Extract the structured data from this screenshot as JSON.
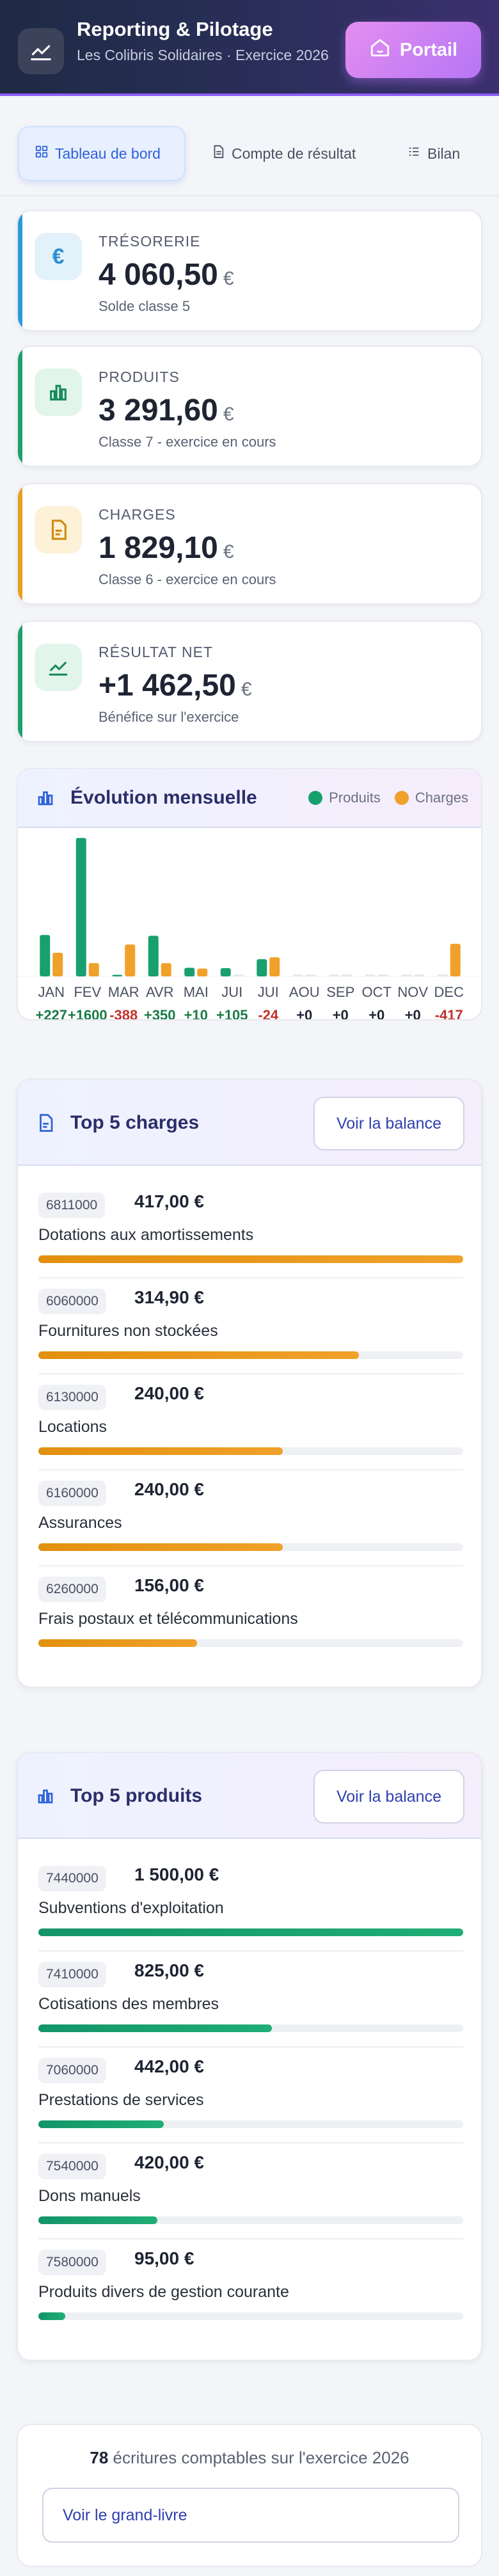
{
  "header": {
    "title": "Reporting & Pilotage",
    "subtitle": "Les Colibris Solidaires · Exercice 2026",
    "portal_label": "Portail"
  },
  "tabs": [
    {
      "label": "Tableau de bord",
      "active": true
    },
    {
      "label": "Compte de résultat",
      "active": false
    },
    {
      "label": "Bilan",
      "active": false
    }
  ],
  "stats": [
    {
      "label": "TRÉSORERIE",
      "value": "4 060,50",
      "currency": "€",
      "sub": "Solde classe 5",
      "accent": "#2b9bd8",
      "icon": "euro-icon"
    },
    {
      "label": "PRODUITS",
      "value": "3 291,60",
      "currency": "€",
      "sub": "Classe 7 - exercice en cours",
      "accent": "#1ea06a",
      "icon": "bar-chart-icon"
    },
    {
      "label": "CHARGES",
      "value": "1 829,10",
      "currency": "€",
      "sub": "Classe 6 - exercice en cours",
      "accent": "#e5a020",
      "icon": "document-icon"
    },
    {
      "label": "RÉSULTAT NET",
      "value": "+1 462,50",
      "currency": "€",
      "sub": "Bénéfice sur l'exercice",
      "accent": "#1ea06a",
      "icon": "trend-icon"
    }
  ],
  "chart": {
    "title": "Évolution mensuelle",
    "legend_produits": "Produits",
    "legend_charges": "Charges",
    "colors": {
      "produits": "#18a06e",
      "charges": "#f0a12a",
      "positive": "#1a7a47",
      "negative": "#c0312b"
    }
  },
  "chart_data": {
    "type": "bar",
    "categories": [
      "JAN",
      "FEV",
      "MAR",
      "AVR",
      "MAI",
      "JUI",
      "JUI",
      "AOU",
      "SEP",
      "OCT",
      "NOV",
      "DEC"
    ],
    "series": [
      {
        "name": "Produits",
        "values": [
          530,
          1770,
          20,
          520,
          110,
          105,
          220,
          0,
          0,
          0,
          0,
          0
        ]
      },
      {
        "name": "Charges",
        "values": [
          303,
          170,
          408,
          170,
          100,
          0,
          244,
          0,
          0,
          0,
          0,
          417
        ]
      }
    ],
    "net_labels": [
      "+227",
      "+1600",
      "-388",
      "+350",
      "+10",
      "+105",
      "-24",
      "+0",
      "+0",
      "+0",
      "+0",
      "-417"
    ],
    "ylim": [
      0,
      1800
    ]
  },
  "top_charges": {
    "title": "Top 5 charges",
    "button": "Voir la balance",
    "items": [
      {
        "code": "6811000",
        "amount": "417,00 €",
        "name": "Dotations aux amortissements",
        "ratio": 1.0
      },
      {
        "code": "6060000",
        "amount": "314,90 €",
        "name": "Fournitures non stockées",
        "ratio": 0.755
      },
      {
        "code": "6130000",
        "amount": "240,00 €",
        "name": "Locations",
        "ratio": 0.576
      },
      {
        "code": "6160000",
        "amount": "240,00 €",
        "name": "Assurances",
        "ratio": 0.576
      },
      {
        "code": "6260000",
        "amount": "156,00 €",
        "name": "Frais postaux et télécommunications",
        "ratio": 0.374
      }
    ]
  },
  "top_produits": {
    "title": "Top 5 produits",
    "button": "Voir la balance",
    "items": [
      {
        "code": "7440000",
        "amount": "1 500,00 €",
        "name": "Subventions d'exploitation",
        "ratio": 1.0
      },
      {
        "code": "7410000",
        "amount": "825,00 €",
        "name": "Cotisations des membres",
        "ratio": 0.55
      },
      {
        "code": "7060000",
        "amount": "442,00 €",
        "name": "Prestations de services",
        "ratio": 0.295
      },
      {
        "code": "7540000",
        "amount": "420,00 €",
        "name": "Dons manuels",
        "ratio": 0.28
      },
      {
        "code": "7580000",
        "amount": "95,00 €",
        "name": "Produits divers de gestion courante",
        "ratio": 0.063
      }
    ]
  },
  "footer": {
    "count": "78",
    "text": "écritures comptables sur l'exercice 2026",
    "button": "Voir le grand-livre"
  }
}
